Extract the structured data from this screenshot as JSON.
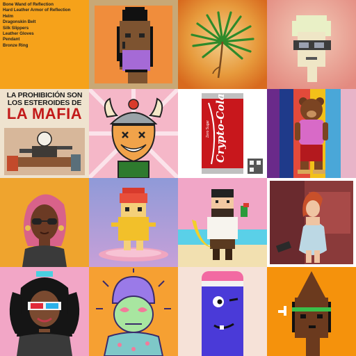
{
  "loot_tile": {
    "items": [
      "Bone Wand of Reflection",
      "Hard Leather Armor of Reflection",
      "Helm",
      "Dragonskin Belt",
      "Silk Slippers",
      "Leather Gloves",
      "Pendant",
      "Bronze Ring"
    ]
  },
  "mafia_tile": {
    "line1": "LA PROHIBICIÓN SON",
    "line2": "LOS ESTEROIDES DE",
    "line3": "LA MAFIA"
  },
  "can_tile": {
    "brand": "Crypto-Cola",
    "sub": "Zero Sugar"
  },
  "colors": {
    "orange": "#f6a21a",
    "pink": "#f4b0c7",
    "purple": "#8b5bd6"
  },
  "icons": [
    "punk-avatar-icon",
    "palm-leaf-icon",
    "skull-avatar-icon",
    "shiba-viking-icon",
    "bear-icon",
    "nft-girl-icon",
    "pixel-hotdog-icon",
    "pirate-icon",
    "woman-icon",
    "girl-3d-glasses-icon",
    "purple-hair-icon",
    "purple-creature-icon",
    "brown-punk-icon"
  ]
}
